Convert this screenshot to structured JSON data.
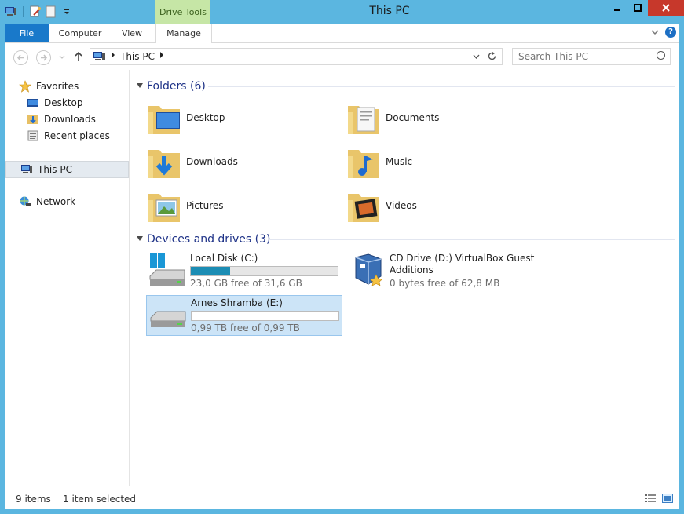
{
  "window": {
    "title": "This PC",
    "context_tab": "Drive Tools",
    "minimize": "–",
    "maximize": "□",
    "close": "✕"
  },
  "ribbon": {
    "tabs": [
      "File",
      "Computer",
      "View",
      "Manage"
    ],
    "help": "?"
  },
  "nav": {
    "breadcrumb": "This PC",
    "search_placeholder": "Search This PC"
  },
  "sidebar": {
    "favorites": "Favorites",
    "items": [
      "Desktop",
      "Downloads",
      "Recent places"
    ],
    "this_pc": "This PC",
    "network": "Network"
  },
  "folders": {
    "header": "Folders (6)",
    "items": [
      "Desktop",
      "Documents",
      "Downloads",
      "Music",
      "Pictures",
      "Videos"
    ]
  },
  "devices": {
    "header": "Devices and drives (3)",
    "drives": [
      {
        "name": "Local Disk (C:)",
        "free_text": "23,0 GB free of 31,6 GB",
        "used_fraction": 0.27
      },
      {
        "name": "CD Drive (D:) VirtualBox Guest",
        "name2": "Additions",
        "free_text": "0 bytes free of 62,8 MB"
      },
      {
        "name": "Arnes Shramba (E:)",
        "free_text": "0,99 TB free of 0,99 TB",
        "used_fraction": 0.0
      }
    ]
  },
  "status": {
    "items": "9 items",
    "selected": "1 item selected"
  },
  "colors": {
    "frame": "#5bb6e0",
    "file_tab": "#1979ca",
    "drive_tools": "#c6e6a6",
    "header_text": "#1e3287",
    "usage_bar": "#1c8db4",
    "selection": "#cce4f7"
  }
}
